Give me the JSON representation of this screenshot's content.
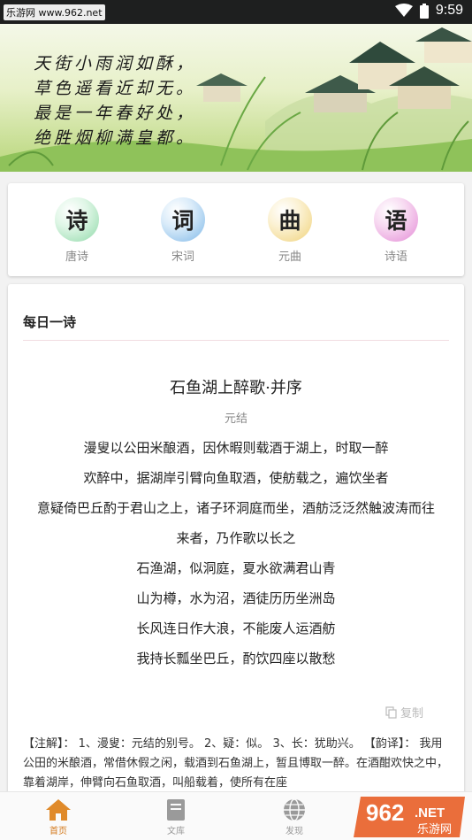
{
  "status_bar": {
    "watermark": "乐游网 www.962.net",
    "time": "9:59"
  },
  "banner": {
    "lines": [
      "天街小雨润如酥，",
      "草色遥看近却无。",
      "最是一年春好处，",
      "绝胜烟柳满皇都。"
    ]
  },
  "categories": [
    {
      "glyph": "诗",
      "label": "唐诗",
      "color": "#8fd9a8"
    },
    {
      "glyph": "词",
      "label": "宋词",
      "color": "#7fb8e8"
    },
    {
      "glyph": "曲",
      "label": "元曲",
      "color": "#f0d27a"
    },
    {
      "glyph": "语",
      "label": "诗语",
      "color": "#e48ad6"
    }
  ],
  "daily": {
    "section_title": "每日一诗",
    "title": "石鱼湖上醉歌·并序",
    "author": "元结",
    "lines": [
      "漫叟以公田米酿酒，因休暇则载酒于湖上，时取一醉",
      "欢醉中，据湖岸引臂向鱼取酒，使舫载之，遍饮坐者",
      "意疑倚巴丘酌于君山之上，诸子环洞庭而坐，酒舫泛泛然触波涛而往",
      "来者，乃作歌以长之",
      "石渔湖，似洞庭，夏水欲满君山青",
      "山为樽，水为沼，酒徒历历坐洲岛",
      "长风连日作大浪，不能废人运酒舫",
      "我持长瓢坐巴丘，酌饮四座以散愁"
    ],
    "copy_label": "复制",
    "note": "【注解】： 1、漫叟：元结的别号。 2、疑：似。 3、长：犹助兴。 【韵译】： 我用公田的米酿酒，常借休假之闲，载酒到石鱼湖上，暂且博取一醉。在酒酣欢快之中，靠着湖岸，伸臂向石鱼取酒，叫船载着，使所有在座"
  },
  "nav": [
    {
      "label": "首页",
      "icon": "home-icon"
    },
    {
      "label": "文库",
      "icon": "book-icon"
    },
    {
      "label": "发现",
      "icon": "globe-icon"
    }
  ],
  "bottom_watermark": {
    "logo": "962",
    "suffix": ".NET",
    "caption": "乐游网"
  },
  "colors": {
    "active": "#d47a1c",
    "inactive": "#999999"
  }
}
